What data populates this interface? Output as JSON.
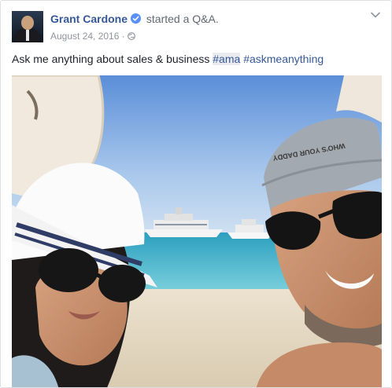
{
  "post": {
    "author": "Grant Cardone",
    "action": "started a Q&A.",
    "date": "August 24, 2016",
    "separator": "·",
    "text_prefix": "Ask me anything about sales & business",
    "hashtags": [
      "#ama",
      "#askmeanything"
    ],
    "photo_cap_text": "WHO'S YOUR DADDY"
  },
  "icons": {
    "verified": "verified-badge-icon",
    "privacy": "globe-icon",
    "menu": "chevron-down-icon"
  },
  "colors": {
    "author_link": "#365899",
    "verified_badge": "#5890ff",
    "meta_text": "#90949c",
    "body_text": "#1d2129"
  }
}
